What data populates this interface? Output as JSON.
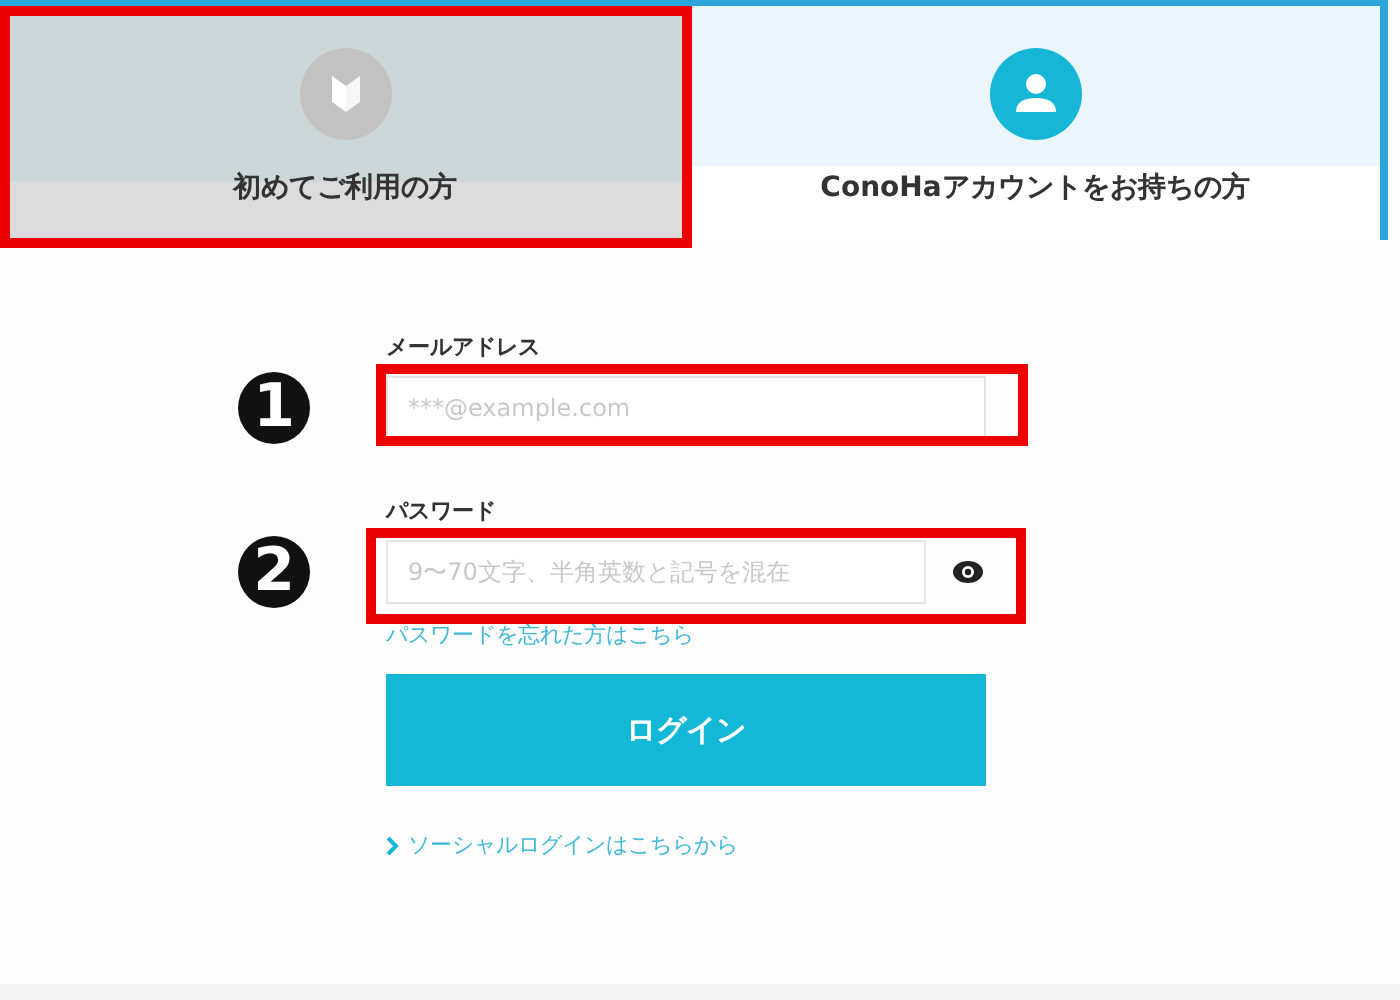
{
  "tabs": [
    {
      "label": "初めてご利用の方",
      "kind": "beginner",
      "selected": false
    },
    {
      "label": "ConoHaアカウントをお持ちの方",
      "kind": "person",
      "selected": true
    }
  ],
  "form": {
    "email": {
      "label": "メールアドレス",
      "placeholder": "***@example.com",
      "marker": "1"
    },
    "password": {
      "label": "パスワード",
      "placeholder": "9〜70文字、半角英数と記号を混在",
      "marker": "2"
    },
    "forgot_link": "パスワードを忘れた方はこちら",
    "login_button": "ログイン",
    "social_link": "ソーシャルログインはこちらから"
  }
}
